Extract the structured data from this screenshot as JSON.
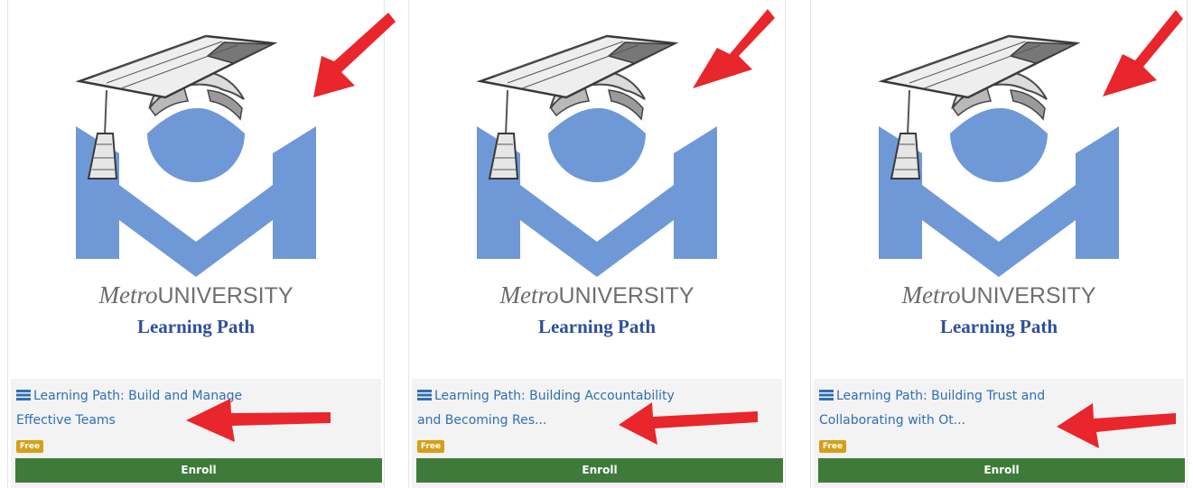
{
  "courses": [
    {
      "brand_metro": "Metro",
      "brand_university": "UNIVERSITY",
      "brand_subtitle": "Learning Path",
      "title_line1": "Learning Path: Build and Manage",
      "title_line2": "Effective Teams",
      "badge": "Free",
      "enroll_label": "Enroll"
    },
    {
      "brand_metro": "Metro",
      "brand_university": "UNIVERSITY",
      "brand_subtitle": "Learning Path",
      "title_line1": "Learning Path: Building Accountability",
      "title_line2": "and Becoming Res...",
      "badge": "Free",
      "enroll_label": "Enroll"
    },
    {
      "brand_metro": "Metro",
      "brand_university": "UNIVERSITY",
      "brand_subtitle": "Learning Path",
      "title_line1": "Learning Path: Building Trust and",
      "title_line2": "Collaborating with Ot...",
      "badge": "Free",
      "enroll_label": "Enroll"
    }
  ],
  "colors": {
    "logo_blue": "#6f98d6",
    "title_link": "#2e6fb5",
    "badge": "#d4a017",
    "enroll_button": "#3e7a3a",
    "annotation_arrow": "#e8262b"
  },
  "icons": {
    "title_prefix": "list-icon",
    "logo": "graduation-cap-logo"
  }
}
